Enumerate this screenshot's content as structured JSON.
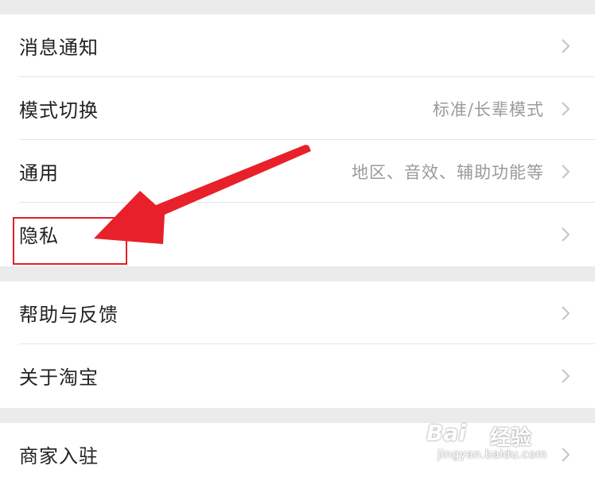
{
  "settings": {
    "group1": [
      {
        "label": "消息通知",
        "value": ""
      },
      {
        "label": "模式切换",
        "value": "标准/长辈模式"
      },
      {
        "label": "通用",
        "value": "地区、音效、辅助功能等"
      },
      {
        "label": "隐私",
        "value": ""
      }
    ],
    "group2": [
      {
        "label": "帮助与反馈",
        "value": ""
      },
      {
        "label": "关于淘宝",
        "value": ""
      }
    ],
    "group3": [
      {
        "label": "商家入驻",
        "value": ""
      }
    ]
  },
  "annotation": {
    "highlight_color": "#e0202c",
    "arrow_color": "#e8202a"
  },
  "watermark": {
    "brand": "Bai",
    "service": "经验",
    "url": "jingyan.baidu.com"
  }
}
